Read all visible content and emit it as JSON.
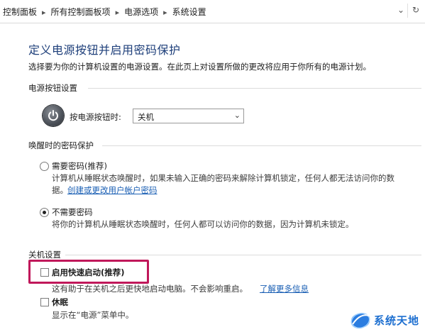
{
  "address_bar": {
    "crumbs": [
      "控制面板",
      "所有控制面板项",
      "电源选项",
      "系统设置"
    ],
    "dropdown_icon": "chevron-down-icon",
    "refresh_icon": "refresh-icon"
  },
  "page": {
    "title": "定义电源按钮并启用密码保护",
    "description": "选择要为你的计算机设置的电源设置。在此页上对设置所做的更改将应用于你所有的电源计划。"
  },
  "power_button_section": {
    "heading": "电源按钮设置",
    "label": "按电源按钮时:",
    "selected": "关机"
  },
  "wake_password_section": {
    "heading": "唤醒时的密码保护",
    "options": [
      {
        "title": "需要密码(推荐)",
        "desc1": "计算机从睡眠状态唤醒时，如果未输入正确的密码来解除计算机锁定，任何人都无法访问你的数",
        "desc2": "据。",
        "link": "创建或更改用户帐户密码",
        "selected": false
      },
      {
        "title": "不需要密码",
        "desc1": "将你的计算机从睡眠状态唤醒时，任何人都可以访问你的数据，因为计算机未锁定。",
        "selected": true
      }
    ]
  },
  "shutdown_section": {
    "heading": "关机设置",
    "fast_startup": {
      "label": "启用快速启动(推荐)",
      "desc": "这有助于在关机之后更快地启动电脑。不会影响重启。",
      "link": "了解更多信息",
      "checked": false
    },
    "hibernate": {
      "label": "休眠",
      "desc": "显示在“电源”菜单中。",
      "checked": false
    }
  },
  "watermark": {
    "text": "系统天地"
  },
  "colors": {
    "title": "#1e3f7a",
    "link": "#1a5fb4",
    "highlight": "#c0185a"
  }
}
